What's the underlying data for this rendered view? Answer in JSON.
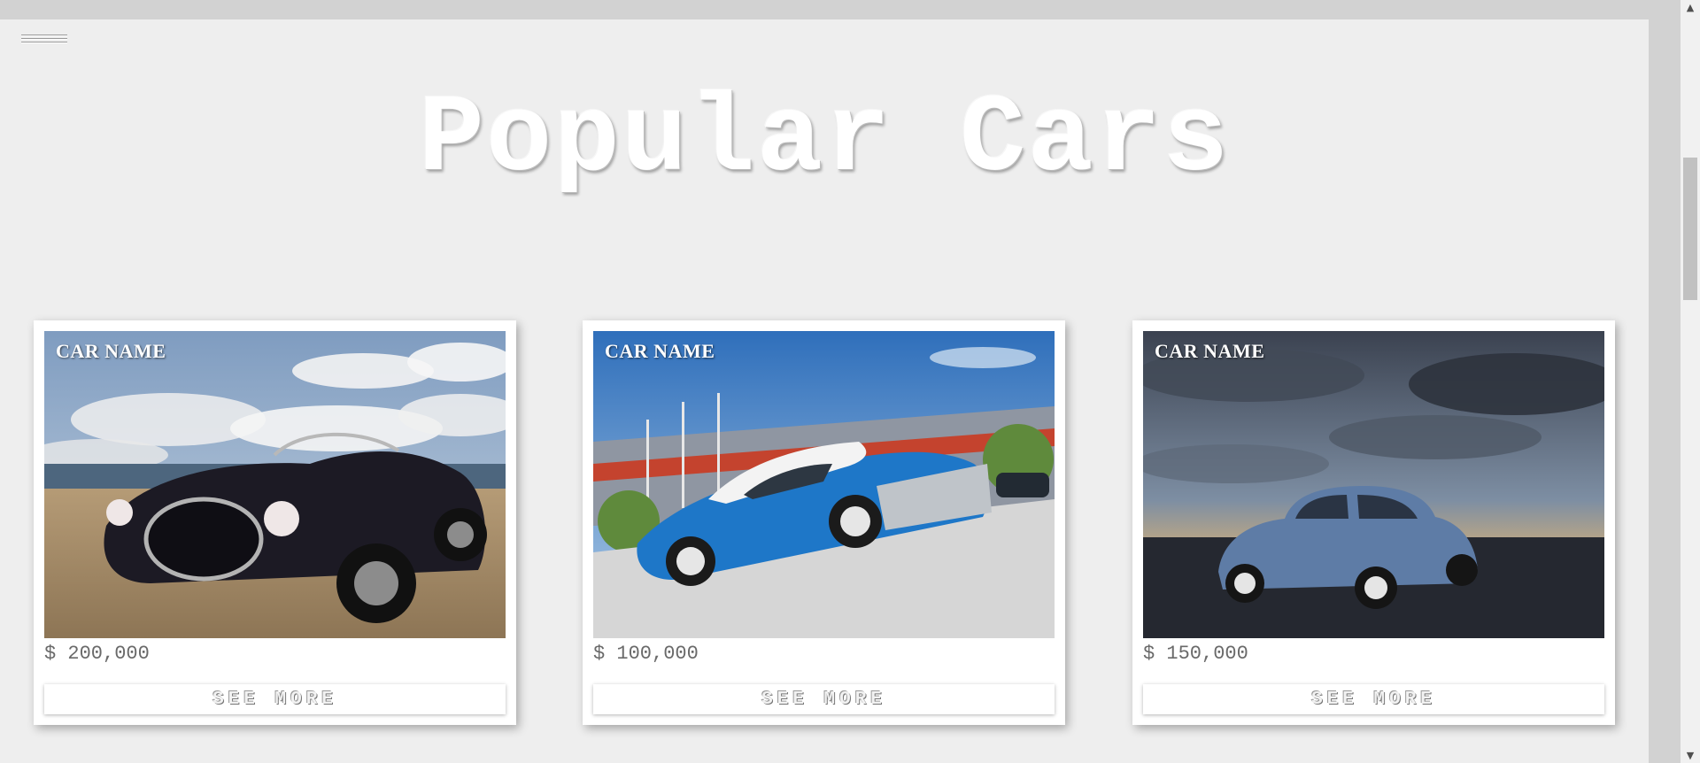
{
  "header": {
    "title": "Popular Cars"
  },
  "menu": {
    "icon": "hamburger-menu-icon"
  },
  "cards": [
    {
      "name": "CAR NAME",
      "price": "$ 200,000",
      "button": "SEE MORE",
      "image": "black-roadster-on-beach-photo"
    },
    {
      "name": "CAR NAME",
      "price": "$ 100,000",
      "button": "SEE MORE",
      "image": "blue-vintage-sedan-photo"
    },
    {
      "name": "CAR NAME",
      "price": "$ 150,000",
      "button": "SEE MORE",
      "image": "blue-beetle-at-sunset-photo"
    }
  ],
  "scrollbar": {
    "up_icon": "▲",
    "down_icon": "▼"
  }
}
